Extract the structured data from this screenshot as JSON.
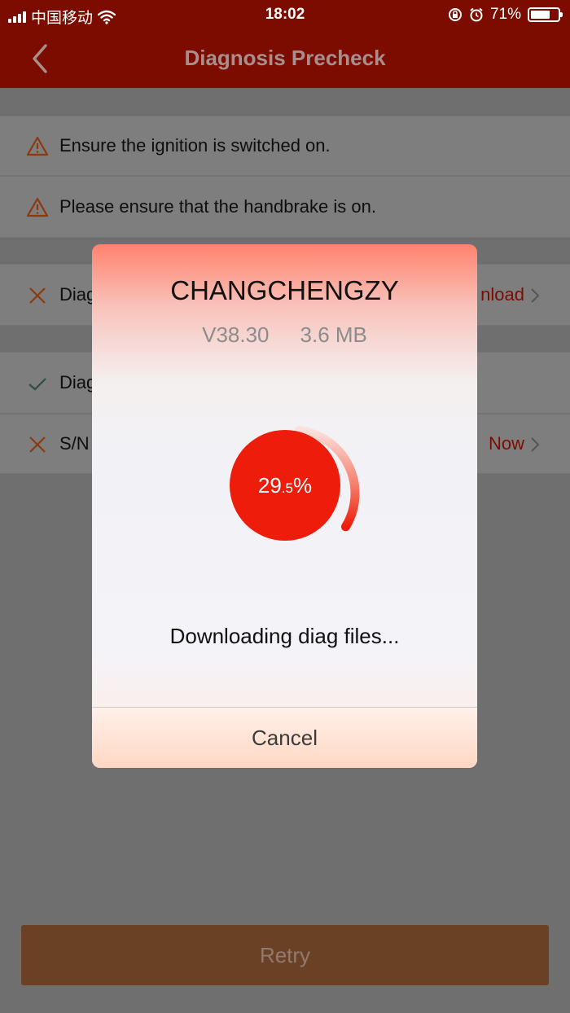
{
  "status_bar": {
    "carrier": "中国移动",
    "time": "18:02",
    "battery": "71%",
    "battery_level": 0.71
  },
  "nav": {
    "title": "Diagnosis Precheck"
  },
  "rows": [
    {
      "icon": "warning-icon",
      "text": "Ensure the ignition is switched on."
    },
    {
      "icon": "warning-icon",
      "text": "Please ensure that the handbrake is on."
    },
    {
      "icon": "cross-icon",
      "text": "Diag",
      "action": "nload"
    },
    {
      "icon": "check-icon",
      "text": "Diag"
    },
    {
      "icon": "cross-icon",
      "text": "S/N",
      "action": "Now"
    }
  ],
  "retry_label": "Retry",
  "modal": {
    "name": "CHANGCHENGZY",
    "version": "V38.30",
    "size": "3.6 MB",
    "progress_whole": "29",
    "progress_decimal": ".5",
    "progress_unit": "%",
    "progress_value": 0.295,
    "message": "Downloading diag files...",
    "cancel_label": "Cancel"
  },
  "colors": {
    "accent": "#ee1c0a",
    "nav": "#7d0c00"
  }
}
